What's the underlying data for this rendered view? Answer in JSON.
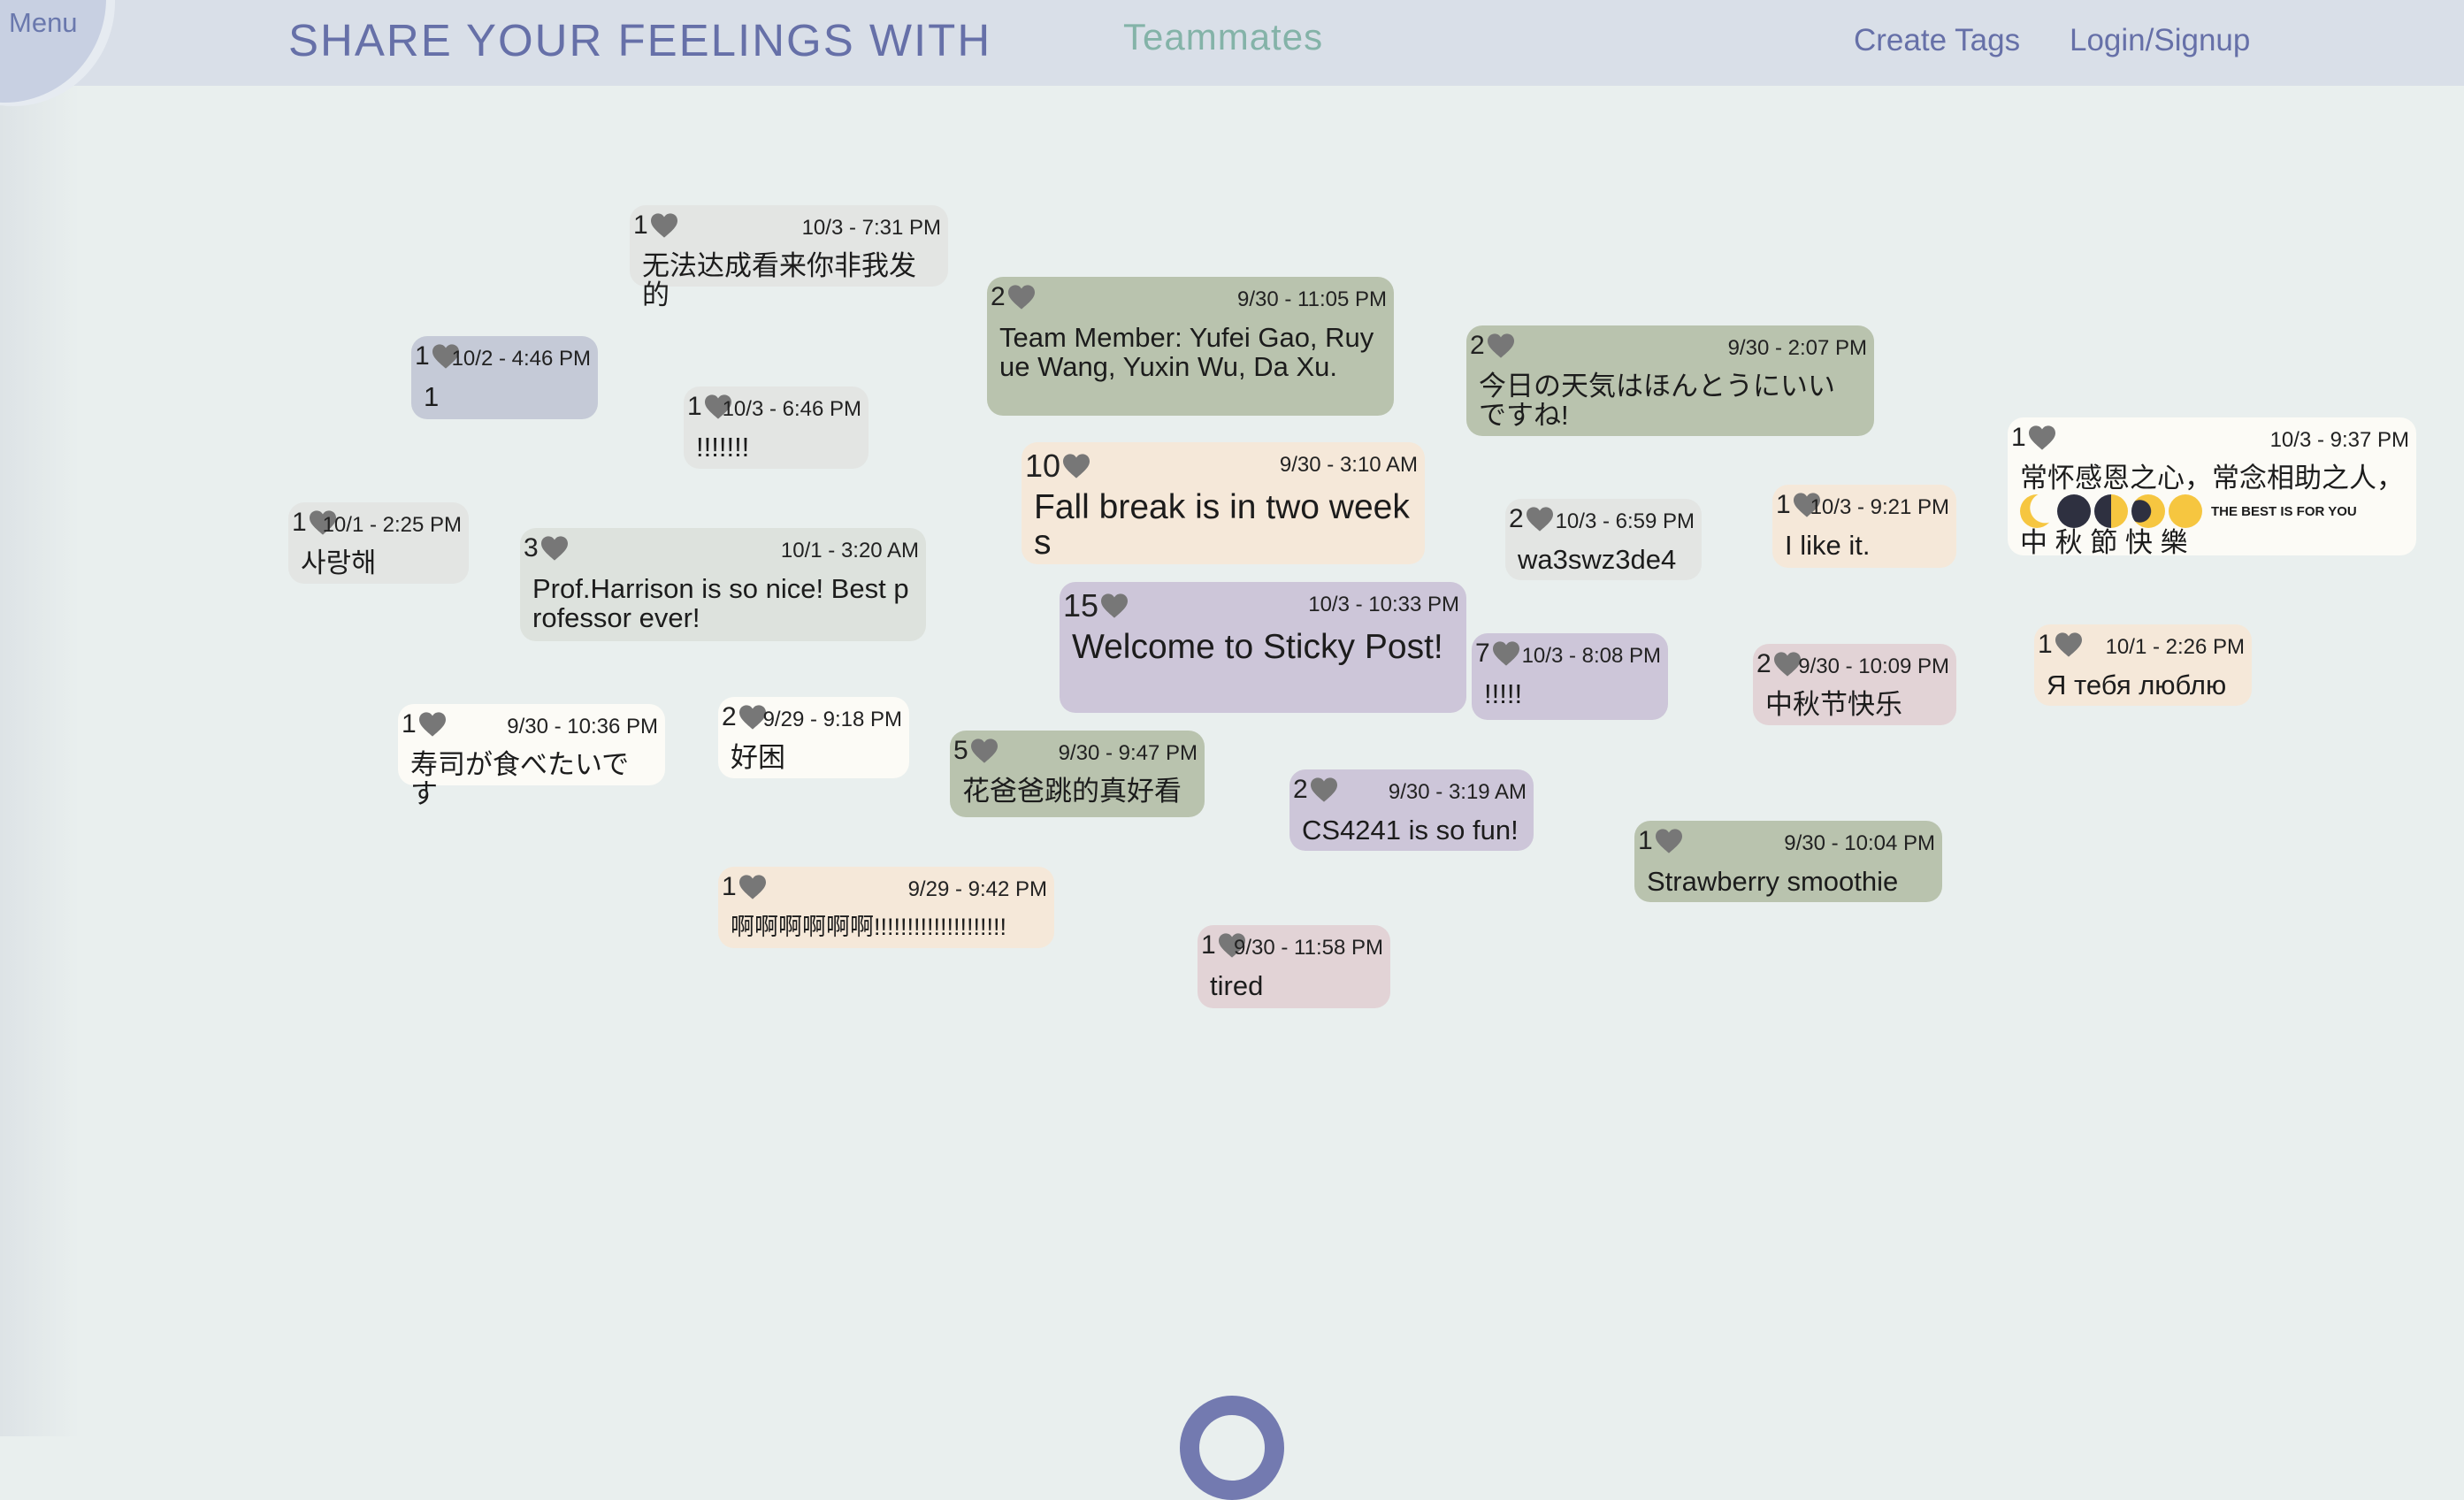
{
  "header": {
    "menu_label": "Menu",
    "title": "SHARE YOUR FEELINGS WITH",
    "title_highlight": "Teammates",
    "nav": [
      "Create Tags",
      "Login/Signup"
    ]
  },
  "colors": {
    "accent": "#6670a8",
    "teal": "#84b3a8",
    "heart": "#7a7a7a"
  },
  "notes": [
    {
      "likes": "1",
      "date": "10/3 - 7:31 PM",
      "text": "无法达成看来你非我发的"
    },
    {
      "likes": "2",
      "date": "9/30 - 11:05 PM",
      "text": "Team Member:  Yufei Gao,  Ruyue Wang, Yuxin Wu, Da Xu."
    },
    {
      "likes": "2",
      "date": "9/30 - 2:07 PM",
      "text": "今日の天気はほんとうにいいですね!"
    },
    {
      "likes": "1",
      "date": "10/3 - 9:37 PM",
      "text": "常怀感恩之心，常念相助之人，",
      "text2": "THE BEST IS FOR YOU",
      "text3": "中 秋 節 快 樂"
    },
    {
      "likes": "1",
      "date": "10/2 - 4:46 PM",
      "text": "1"
    },
    {
      "likes": "1",
      "date": "10/3 - 6:46 PM",
      "text": "!!!!!!!"
    },
    {
      "likes": "10",
      "date": "9/30 - 3:10 AM",
      "text": "Fall break is in two weeks"
    },
    {
      "likes": "2",
      "date": "10/3 - 6:59 PM",
      "text": "wa3swz3de4"
    },
    {
      "likes": "1",
      "date": "10/3 - 9:21 PM",
      "text": "I like it."
    },
    {
      "likes": "1",
      "date": "10/1 - 2:25 PM",
      "text": "사랑해"
    },
    {
      "likes": "3",
      "date": "10/1 - 3:20 AM",
      "text": "Prof.Harrison is so nice! Best professor ever!"
    },
    {
      "likes": "15",
      "date": "10/3 - 10:33 PM",
      "text": "Welcome to Sticky Post!"
    },
    {
      "likes": "7",
      "date": "10/3 - 8:08 PM",
      "text": "!!!!!"
    },
    {
      "likes": "2",
      "date": "9/30 - 10:09 PM",
      "text": "中秋节快乐"
    },
    {
      "likes": "1",
      "date": "10/1 - 2:26 PM",
      "text": "Я тебя люблю"
    },
    {
      "likes": "1",
      "date": "9/30 - 10:36 PM",
      "text": "寿司が食べたいです"
    },
    {
      "likes": "2",
      "date": "9/29 - 9:18 PM",
      "text": "好困"
    },
    {
      "likes": "5",
      "date": "9/30 - 9:47 PM",
      "text": "花爸爸跳的真好看"
    },
    {
      "likes": "2",
      "date": "9/30 - 3:19 AM",
      "text": "CS4241 is so fun!"
    },
    {
      "likes": "1",
      "date": "9/30 - 10:04 PM",
      "text": "Strawberry smoothie"
    },
    {
      "likes": "1",
      "date": "9/29 - 9:42 PM",
      "text": "啊啊啊啊啊啊!!!!!!!!!!!!!!!!!!!!"
    },
    {
      "likes": "1",
      "date": "9/30 - 11:58 PM",
      "text": "tired"
    }
  ]
}
